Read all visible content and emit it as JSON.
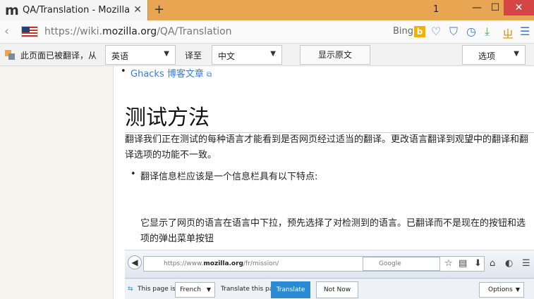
{
  "browser": {
    "tab_title": "QA/Translation - Mozilla...",
    "logo_letter": "m",
    "tab_close": "✕",
    "new_tab": "+",
    "counter": "1",
    "url_prefix": "https://wiki.",
    "url_domain": "mozilla.org",
    "url_path": "/QA/Translation",
    "search_engine": "Bing",
    "bing_letter": "b"
  },
  "translation_bar": {
    "message": "此页面已被翻译，从",
    "from_language": "英语",
    "to_label": "译至",
    "to_language": "中文",
    "show_original": "显示原文",
    "options": "选项"
  },
  "content": {
    "link_text": "Ghacks 博客文章",
    "heading": "测试方法",
    "paragraph": "翻译我们正在测试的每种语言才能看到是否网页经过适当的翻译。更改语言翻译到观望中的翻译和翻译选项的功能不一致。",
    "bullet": "翻译信息栏应该是一个信息栏具有以下特点:",
    "paragraph2": "它显示了网页的语言在语言中下拉，预先选择了对检测到的语言。已翻译而不是现在的按钮和选项的弹出菜单按钮"
  },
  "embedded": {
    "url_prefix": "https://www.",
    "url_domain": "mozilla.org",
    "url_path": "/fr/mission/",
    "search_placeholder": "Google",
    "page_is_in": "This page is in",
    "language": "French",
    "translate_question": "Translate this page?",
    "translate_button": "Translate",
    "not_now_button": "Not Now",
    "options": "Options"
  }
}
